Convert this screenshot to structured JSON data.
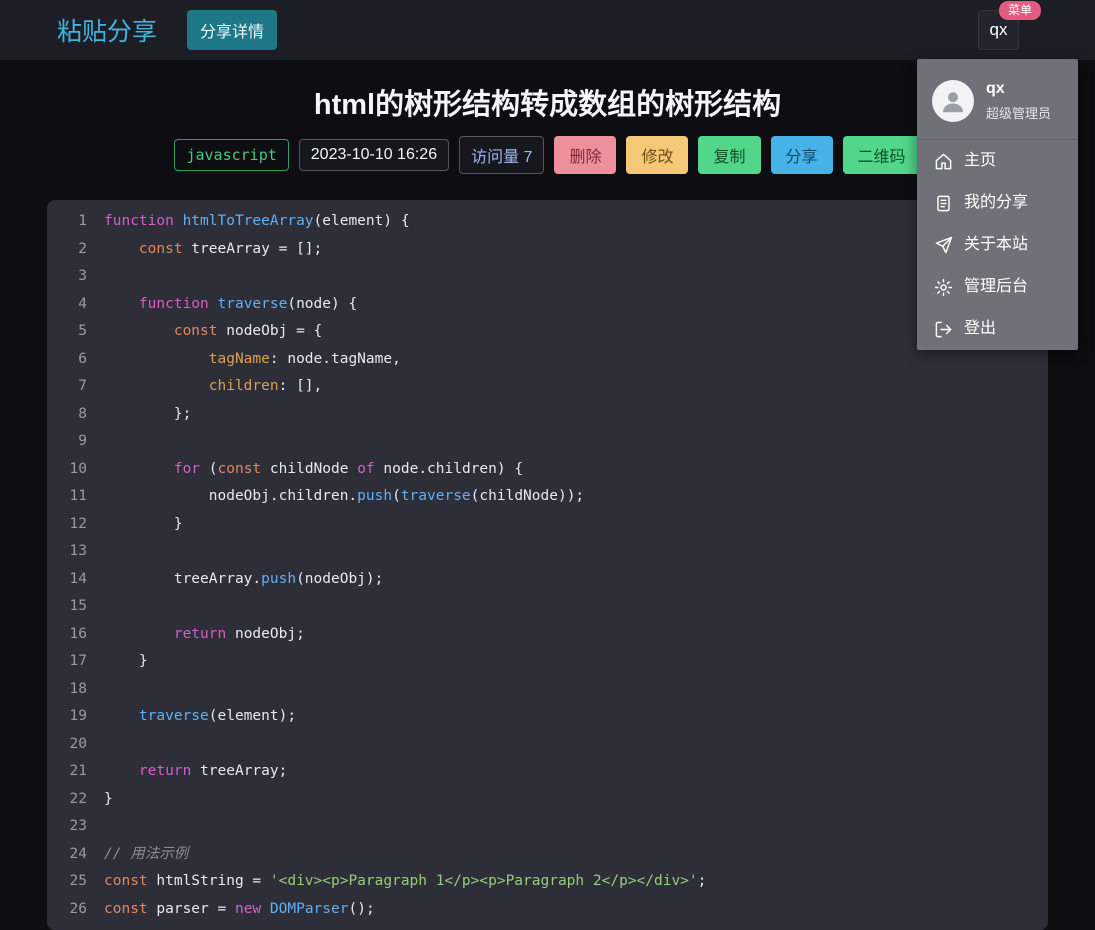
{
  "navbar": {
    "brand": "粘贴分享",
    "detail_button": "分享详情",
    "user_button": "qx",
    "menu_badge": "菜单"
  },
  "post": {
    "title": "html的树形结构转成数组的树形结构",
    "language": "javascript",
    "date": "2023-10-10 16:26",
    "visits_label": "访问量 7"
  },
  "actions": [
    {
      "label": "删除",
      "type": "delete"
    },
    {
      "label": "修改",
      "type": "edit"
    },
    {
      "label": "复制",
      "type": "copy"
    },
    {
      "label": "分享",
      "type": "share"
    },
    {
      "label": "二维码",
      "type": "qrcode"
    }
  ],
  "dropdown": {
    "username": "qx",
    "role": "超级管理员",
    "items": [
      {
        "label": "主页",
        "icon": "home-icon"
      },
      {
        "label": "我的分享",
        "icon": "document-icon"
      },
      {
        "label": "关于本站",
        "icon": "send-icon"
      },
      {
        "label": "管理后台",
        "icon": "gear-icon"
      },
      {
        "label": "登出",
        "icon": "logout-icon"
      }
    ]
  },
  "code": {
    "language": "javascript",
    "lines": [
      [
        [
          "kw",
          "function"
        ],
        [
          "p",
          " "
        ],
        [
          "fn",
          "htmlToTreeArray"
        ],
        [
          "p",
          "(element) {"
        ]
      ],
      [
        [
          "p",
          "    "
        ],
        [
          "kw2",
          "const"
        ],
        [
          "p",
          " treeArray = [];"
        ]
      ],
      [],
      [
        [
          "p",
          "    "
        ],
        [
          "kw",
          "function"
        ],
        [
          "p",
          " "
        ],
        [
          "fn",
          "traverse"
        ],
        [
          "p",
          "(node) {"
        ]
      ],
      [
        [
          "p",
          "        "
        ],
        [
          "kw2",
          "const"
        ],
        [
          "p",
          " nodeObj = {"
        ]
      ],
      [
        [
          "p",
          "            "
        ],
        [
          "prop",
          "tagName"
        ],
        [
          "p",
          ": node.tagName,"
        ]
      ],
      [
        [
          "p",
          "            "
        ],
        [
          "prop",
          "children"
        ],
        [
          "p",
          ": [],"
        ]
      ],
      [
        [
          "p",
          "        };"
        ]
      ],
      [],
      [
        [
          "p",
          "        "
        ],
        [
          "kw",
          "for"
        ],
        [
          "p",
          " ("
        ],
        [
          "kw2",
          "const"
        ],
        [
          "p",
          " childNode "
        ],
        [
          "kw",
          "of"
        ],
        [
          "p",
          " node.children) {"
        ]
      ],
      [
        [
          "p",
          "            nodeObj.children."
        ],
        [
          "fn",
          "push"
        ],
        [
          "p",
          "("
        ],
        [
          "fn",
          "traverse"
        ],
        [
          "p",
          "(childNode));"
        ]
      ],
      [
        [
          "p",
          "        }"
        ]
      ],
      [],
      [
        [
          "p",
          "        treeArray."
        ],
        [
          "fn",
          "push"
        ],
        [
          "p",
          "(nodeObj);"
        ]
      ],
      [],
      [
        [
          "p",
          "        "
        ],
        [
          "kw",
          "return"
        ],
        [
          "p",
          " nodeObj;"
        ]
      ],
      [
        [
          "p",
          "    }"
        ]
      ],
      [],
      [
        [
          "p",
          "    "
        ],
        [
          "fn",
          "traverse"
        ],
        [
          "p",
          "(element);"
        ]
      ],
      [],
      [
        [
          "p",
          "    "
        ],
        [
          "kw",
          "return"
        ],
        [
          "p",
          " treeArray;"
        ]
      ],
      [
        [
          "p",
          "}"
        ]
      ],
      [],
      [
        [
          "cmt",
          "// 用法示例"
        ]
      ],
      [
        [
          "kw2",
          "const"
        ],
        [
          "p",
          " htmlString = "
        ],
        [
          "str",
          "'<div><p>Paragraph 1</p><p>Paragraph 2</p></div>'"
        ],
        [
          "p",
          ";"
        ]
      ],
      [
        [
          "kw2",
          "const"
        ],
        [
          "p",
          " parser = "
        ],
        [
          "kw",
          "new"
        ],
        [
          "p",
          " "
        ],
        [
          "fn",
          "DOMParser"
        ],
        [
          "p",
          "();"
        ]
      ]
    ]
  },
  "colors": {
    "brand": "#41b4dd",
    "navbar_bg": "#1d1d26",
    "page_bg": "#0d0d12",
    "code_bg": "#2e2e39",
    "menu_badge": "#e25a80",
    "detail_button": "#1e7787",
    "delete_button": "#ee8f9c",
    "edit_button": "#f5c878",
    "copy_button": "#52d68a",
    "share_button": "#45b3e8",
    "qrcode_button": "#52d68a",
    "language_tag": "#49c97e",
    "code_keyword": "#d55fc8",
    "code_const": "#e0875f",
    "code_function": "#5fb0f5",
    "code_string": "#93ce7c",
    "code_comment": "#8b8b95",
    "dropdown_bg": "#707079"
  }
}
